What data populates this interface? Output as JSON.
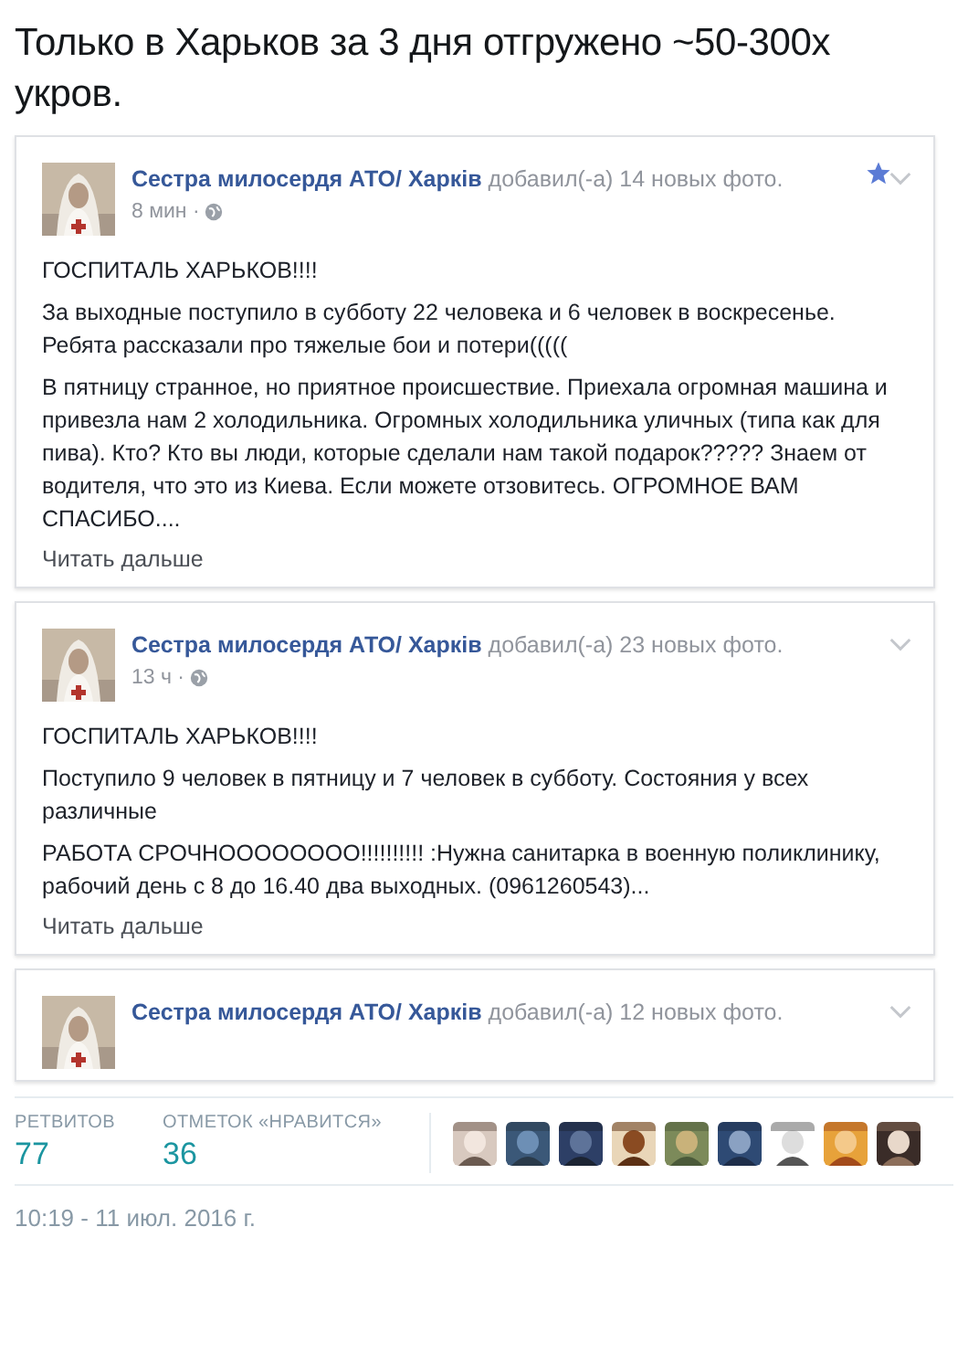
{
  "headline": "Только в Харьков за 3 дня отгружено ~50-300х укров.",
  "posts": [
    {
      "author": "Сестра милосердя АТО/ Харків",
      "action": "добавил(-а) 14 новых фото.",
      "time": "8 мин ·",
      "starred": true,
      "paragraphs": [
        "ГОСПИТАЛЬ ХАРЬКОВ!!!!",
        "За выходные поступило в субботу 22 человека и 6 человек в воскресенье. Ребята рассказали про тяжелые бои и потери(((((",
        "В пятницу странное, но приятное происшествие. Приехала огромная машина и привезла нам 2 холодильника. Огромных холодильника уличных (типа как для пива). Кто? Кто вы люди, которые сделали нам такой подарок????? Знаем от водителя, что это из Киева. Если можете отзовитесь. ОГРОМНОЕ ВАМ СПАСИБО...."
      ],
      "read_more": "Читать дальше"
    },
    {
      "author": "Сестра милосердя АТО/ Харків",
      "action": "добавил(-а) 23 новых фото.",
      "time": "13 ч ·",
      "starred": false,
      "paragraphs": [
        "ГОСПИТАЛЬ ХАРЬКОВ!!!!",
        "Поступило 9 человек в пятницу и 7 человек в субботу. Состояния у всех различные",
        "РАБОТА СРОЧНОООООООО!!!!!!!!!! :Нужна санитарка в военную поликлинику, рабочий день с 8 до 16.40 два выходных. (0961260543)..."
      ],
      "read_more": "Читать дальше"
    },
    {
      "author": "Сестра милосердя АТО/ Харків",
      "action": "добавил(-а) 12 новых фото.",
      "starred": false
    }
  ],
  "stats": [
    {
      "label": "РЕТВИТОВ",
      "value": "77"
    },
    {
      "label": "ОТМЕТОК «НРАВИТСЯ»",
      "value": "36"
    }
  ],
  "timestamp": "10:19 - 11 июл. 2016 г."
}
